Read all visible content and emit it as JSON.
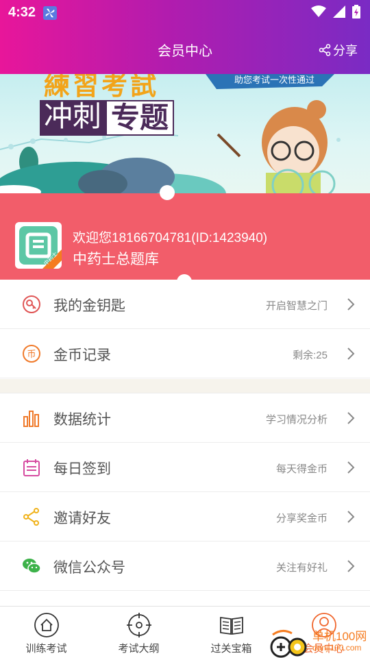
{
  "status_bar": {
    "time": "4:32"
  },
  "header": {
    "title": "会员中心",
    "share_label": "分享"
  },
  "banner": {
    "line1": "練習考試",
    "tagline": "助您考试一次性通过",
    "line2a": "冲刺",
    "line2b": "专题"
  },
  "profile": {
    "welcome": "欢迎您18166704781(ID:1423940)",
    "bank_name": "中药士总题库",
    "avatar_badge": "中药士"
  },
  "menu_group1": [
    {
      "label": "我的金钥匙",
      "hint": "开启智慧之门",
      "icon": "key-icon"
    },
    {
      "label": "金币记录",
      "hint": "剩余:25",
      "icon": "coin-icon"
    }
  ],
  "menu_group2": [
    {
      "label": "数据统计",
      "hint": "学习情况分析",
      "icon": "bar-chart-icon"
    },
    {
      "label": "每日签到",
      "hint": "每天得金币",
      "icon": "calendar-icon"
    },
    {
      "label": "邀请好友",
      "hint": "分享奖金币",
      "icon": "share-icon"
    },
    {
      "label": "微信公众号",
      "hint": "关注有好礼",
      "icon": "wechat-icon"
    }
  ],
  "tabs": [
    {
      "label": "训练考试",
      "icon": "home-icon"
    },
    {
      "label": "考试大纲",
      "icon": "target-icon"
    },
    {
      "label": "过关宝箱",
      "icon": "book-icon"
    },
    {
      "label": "会员中心",
      "icon": "user-icon",
      "active": true
    }
  ],
  "watermark": {
    "text": "单机100网",
    "url": "danji100.com"
  },
  "colors": {
    "header_start": "#e8169a",
    "header_end": "#7a2bc4",
    "profile_bg": "#f25d6a",
    "active_tab": "#f0662d"
  }
}
